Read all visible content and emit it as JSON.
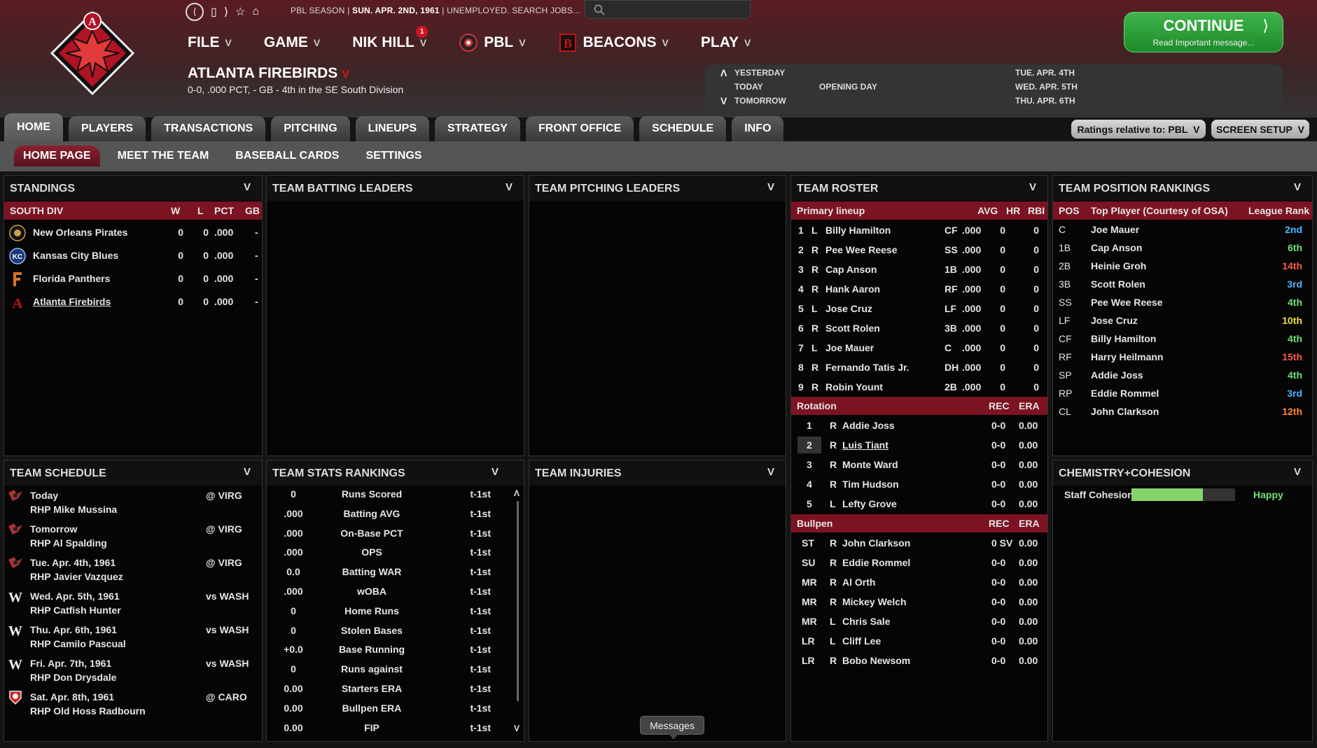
{
  "top": {
    "season_label": "PBL SEASON",
    "date": "SUN. APR. 2ND, 1961",
    "status": "UNEMPLOYED. SEARCH JOBS..."
  },
  "menus": [
    {
      "label": "FILE"
    },
    {
      "label": "GAME"
    },
    {
      "label": "NIK HILL",
      "badge": "1"
    },
    {
      "label": "PBL"
    },
    {
      "label": "BEACONS"
    },
    {
      "label": "PLAY"
    }
  ],
  "team": {
    "name": "ATLANTA FIREBIRDS",
    "record": "0-0, .000 PCT, - GB - 4th in the SE South Division"
  },
  "continue": {
    "label": "CONTINUE",
    "sub": "Read Important message..."
  },
  "calendar": {
    "yesterday": "YESTERDAY",
    "today": "TODAY",
    "tomorrow": "TOMORROW",
    "today_event": "OPENING DAY",
    "dates": [
      "TUE. APR. 4TH",
      "WED. APR. 5TH",
      "THU. APR. 6TH"
    ]
  },
  "tabs": [
    "HOME",
    "PLAYERS",
    "TRANSACTIONS",
    "PITCHING",
    "LINEUPS",
    "STRATEGY",
    "FRONT OFFICE",
    "SCHEDULE",
    "INFO"
  ],
  "subtabs": [
    "HOME PAGE",
    "MEET THE TEAM",
    "BASEBALL CARDS",
    "SETTINGS"
  ],
  "ratings_button": "Ratings relative to: PBL",
  "setup_button": "SCREEN SETUP",
  "standings": {
    "title": "STANDINGS",
    "division": "SOUTH DIV",
    "cols": [
      "W",
      "L",
      "PCT",
      "GB"
    ],
    "rows": [
      {
        "team": "New Orleans Pirates",
        "w": "0",
        "l": "0",
        "pct": ".000",
        "gb": "-"
      },
      {
        "team": "Kansas City Blues",
        "w": "0",
        "l": "0",
        "pct": ".000",
        "gb": "-"
      },
      {
        "team": "Florida Panthers",
        "w": "0",
        "l": "0",
        "pct": ".000",
        "gb": "-"
      },
      {
        "team": "Atlanta Firebirds",
        "w": "0",
        "l": "0",
        "pct": ".000",
        "gb": "-"
      }
    ]
  },
  "batting_leaders": {
    "title": "TEAM BATTING LEADERS"
  },
  "pitching_leaders": {
    "title": "TEAM PITCHING LEADERS"
  },
  "roster": {
    "title": "TEAM ROSTER",
    "lineup_header": {
      "label": "Primary lineup",
      "avg": "AVG",
      "hr": "HR",
      "rbi": "RBI"
    },
    "lineup": [
      {
        "n": "1",
        "hand": "L",
        "name": "Billy Hamilton",
        "pos": "CF",
        "avg": ".000",
        "hr": "0",
        "rbi": "0"
      },
      {
        "n": "2",
        "hand": "R",
        "name": "Pee Wee Reese",
        "pos": "SS",
        "avg": ".000",
        "hr": "0",
        "rbi": "0"
      },
      {
        "n": "3",
        "hand": "R",
        "name": "Cap Anson",
        "pos": "1B",
        "avg": ".000",
        "hr": "0",
        "rbi": "0"
      },
      {
        "n": "4",
        "hand": "R",
        "name": "Hank Aaron",
        "pos": "RF",
        "avg": ".000",
        "hr": "0",
        "rbi": "0"
      },
      {
        "n": "5",
        "hand": "L",
        "name": "Jose Cruz",
        "pos": "LF",
        "avg": ".000",
        "hr": "0",
        "rbi": "0"
      },
      {
        "n": "6",
        "hand": "R",
        "name": "Scott Rolen",
        "pos": "3B",
        "avg": ".000",
        "hr": "0",
        "rbi": "0"
      },
      {
        "n": "7",
        "hand": "L",
        "name": "Joe Mauer",
        "pos": "C",
        "avg": ".000",
        "hr": "0",
        "rbi": "0"
      },
      {
        "n": "8",
        "hand": "R",
        "name": "Fernando Tatis Jr.",
        "pos": "DH",
        "avg": ".000",
        "hr": "0",
        "rbi": "0"
      },
      {
        "n": "9",
        "hand": "R",
        "name": "Robin Yount",
        "pos": "2B",
        "avg": ".000",
        "hr": "0",
        "rbi": "0"
      }
    ],
    "rotation_header": {
      "label": "Rotation",
      "rec": "REC",
      "era": "ERA"
    },
    "rotation": [
      {
        "n": "1",
        "hand": "R",
        "name": "Addie Joss",
        "rec": "0-0",
        "era": "0.00"
      },
      {
        "n": "2",
        "hand": "R",
        "name": "Luis Tiant",
        "rec": "0-0",
        "era": "0.00"
      },
      {
        "n": "3",
        "hand": "R",
        "name": "Monte Ward",
        "rec": "0-0",
        "era": "0.00"
      },
      {
        "n": "4",
        "hand": "R",
        "name": "Tim Hudson",
        "rec": "0-0",
        "era": "0.00"
      },
      {
        "n": "5",
        "hand": "L",
        "name": "Lefty Grove",
        "rec": "0-0",
        "era": "0.00"
      }
    ],
    "bullpen_header": {
      "label": "Bullpen",
      "rec": "REC",
      "era": "ERA"
    },
    "bullpen": [
      {
        "role": "ST",
        "hand": "R",
        "name": "John Clarkson",
        "rec": "0 SV",
        "era": "0.00"
      },
      {
        "role": "SU",
        "hand": "R",
        "name": "Eddie Rommel",
        "rec": "0-0",
        "era": "0.00"
      },
      {
        "role": "MR",
        "hand": "R",
        "name": "Al Orth",
        "rec": "0-0",
        "era": "0.00"
      },
      {
        "role": "MR",
        "hand": "R",
        "name": "Mickey Welch",
        "rec": "0-0",
        "era": "0.00"
      },
      {
        "role": "MR",
        "hand": "L",
        "name": "Chris Sale",
        "rec": "0-0",
        "era": "0.00"
      },
      {
        "role": "LR",
        "hand": "L",
        "name": "Cliff Lee",
        "rec": "0-0",
        "era": "0.00"
      },
      {
        "role": "LR",
        "hand": "R",
        "name": "Bobo Newsom",
        "rec": "0-0",
        "era": "0.00"
      }
    ]
  },
  "position_rankings": {
    "title": "TEAM POSITION RANKINGS",
    "cols": {
      "pos": "POS",
      "player": "Top Player (Courtesy of OSA)",
      "rank": "League Rank"
    },
    "rows": [
      {
        "pos": "C",
        "player": "Joe Mauer",
        "rank": "2nd",
        "color": "#4fb3ff"
      },
      {
        "pos": "1B",
        "player": "Cap Anson",
        "rank": "6th",
        "color": "#6fe07a"
      },
      {
        "pos": "2B",
        "player": "Heinie Groh",
        "rank": "14th",
        "color": "#ff5a4a"
      },
      {
        "pos": "3B",
        "player": "Scott Rolen",
        "rank": "3rd",
        "color": "#4fb3ff"
      },
      {
        "pos": "SS",
        "player": "Pee Wee Reese",
        "rank": "4th",
        "color": "#6fe07a"
      },
      {
        "pos": "LF",
        "player": "Jose Cruz",
        "rank": "10th",
        "color": "#f0e040"
      },
      {
        "pos": "CF",
        "player": "Billy Hamilton",
        "rank": "4th",
        "color": "#6fe07a"
      },
      {
        "pos": "RF",
        "player": "Harry Heilmann",
        "rank": "15th",
        "color": "#ff5a4a"
      },
      {
        "pos": "SP",
        "player": "Addie Joss",
        "rank": "4th",
        "color": "#6fe07a"
      },
      {
        "pos": "RP",
        "player": "Eddie Rommel",
        "rank": "3rd",
        "color": "#4fb3ff"
      },
      {
        "pos": "CL",
        "player": "John Clarkson",
        "rank": "12th",
        "color": "#ff8a30"
      }
    ]
  },
  "schedule": {
    "title": "TEAM SCHEDULE",
    "games": [
      {
        "date": "Today",
        "opp": "@ VIRG",
        "pitcher": "RHP Mike Mussina",
        "logo": "virg"
      },
      {
        "date": "Tomorrow",
        "opp": "@ VIRG",
        "pitcher": "RHP Al Spalding",
        "logo": "virg"
      },
      {
        "date": "Tue. Apr. 4th, 1961",
        "opp": "@ VIRG",
        "pitcher": "RHP Javier Vazquez",
        "logo": "virg"
      },
      {
        "date": "Wed. Apr. 5th, 1961",
        "opp": "vs WASH",
        "pitcher": "RHP Catfish Hunter",
        "logo": "wash"
      },
      {
        "date": "Thu. Apr. 6th, 1961",
        "opp": "vs WASH",
        "pitcher": "RHP Camilo Pascual",
        "logo": "wash"
      },
      {
        "date": "Fri. Apr. 7th, 1961",
        "opp": "vs WASH",
        "pitcher": "RHP Don Drysdale",
        "logo": "wash"
      },
      {
        "date": "Sat. Apr. 8th, 1961",
        "opp": "@ CARO",
        "pitcher": "RHP Old Hoss Radbourn",
        "logo": "caro"
      }
    ]
  },
  "stats_rankings": {
    "title": "TEAM STATS RANKINGS",
    "rows": [
      {
        "value": "0",
        "stat": "Runs Scored",
        "rank": "t-1st"
      },
      {
        "value": ".000",
        "stat": "Batting AVG",
        "rank": "t-1st"
      },
      {
        "value": ".000",
        "stat": "On-Base PCT",
        "rank": "t-1st"
      },
      {
        "value": ".000",
        "stat": "OPS",
        "rank": "t-1st"
      },
      {
        "value": "0.0",
        "stat": "Batting WAR",
        "rank": "t-1st"
      },
      {
        "value": ".000",
        "stat": "wOBA",
        "rank": "t-1st"
      },
      {
        "value": "0",
        "stat": "Home Runs",
        "rank": "t-1st"
      },
      {
        "value": "0",
        "stat": "Stolen Bases",
        "rank": "t-1st"
      },
      {
        "value": "+0.0",
        "stat": "Base Running",
        "rank": "t-1st"
      },
      {
        "value": "0",
        "stat": "Runs against",
        "rank": "t-1st"
      },
      {
        "value": "0.00",
        "stat": "Starters ERA",
        "rank": "t-1st"
      },
      {
        "value": "0.00",
        "stat": "Bullpen ERA",
        "rank": "t-1st"
      },
      {
        "value": "0.00",
        "stat": "FIP",
        "rank": "t-1st"
      }
    ]
  },
  "injuries": {
    "title": "TEAM INJURIES"
  },
  "chemistry": {
    "title": "CHEMISTRY+COHESION",
    "label": "Staff Cohesion",
    "status": "Happy",
    "level": 0.69
  },
  "messages_tooltip": "Messages",
  "colors": {
    "accent": "#7c1322",
    "continue": "#2ea33a",
    "happy": "#6fe07a"
  }
}
